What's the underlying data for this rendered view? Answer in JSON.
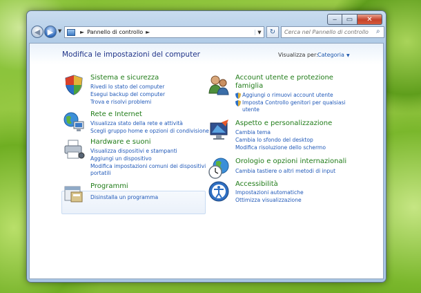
{
  "window": {
    "minimize": "‒",
    "maximize": "▭",
    "close": "✕"
  },
  "navbar": {
    "breadcrumb_sep1": "►",
    "breadcrumb": "Pannello di controllo",
    "breadcrumb_sep2": "►",
    "search_placeholder": "Cerca nel Pannello di controllo"
  },
  "main": {
    "title": "Modifica le impostazioni del computer",
    "view_label": "Visualizza per:",
    "view_value": "Categoria"
  },
  "categories_left": [
    {
      "title": "Sistema e sicurezza",
      "links": [
        "Rivedi lo stato del computer",
        "Esegui backup del computer",
        "Trova e risolvi problemi"
      ]
    },
    {
      "title": "Rete e Internet",
      "links": [
        "Visualizza stato della rete e attività",
        "Scegli gruppo home e opzioni di condivisione"
      ]
    },
    {
      "title": "Hardware e suoni",
      "links": [
        "Visualizza dispositivi e stampanti",
        "Aggiungi un dispositivo",
        "Modifica impostazioni comuni dei dispositivi",
        "portatili"
      ]
    },
    {
      "title": "Programmi",
      "links": [
        "Disinstalla un programma"
      ]
    }
  ],
  "categories_right": [
    {
      "title_line1": "Account utente e protezione",
      "title_line2": "famiglia",
      "links": [
        "Aggiungi o rimuovi account utente",
        "Imposta Controllo genitori per qualsiasi",
        "utente"
      ]
    },
    {
      "title": "Aspetto e personalizzazione",
      "links": [
        "Cambia tema",
        "Cambia lo sfondo del desktop",
        "Modifica risoluzione dello schermo"
      ]
    },
    {
      "title": "Orologio e opzioni internazionali",
      "links": [
        "Cambia tastiere o altri metodi di input"
      ]
    },
    {
      "title": "Accessibilità",
      "links": [
        "Impostazioni automatiche",
        "Ottimizza visualizzazione"
      ]
    }
  ]
}
